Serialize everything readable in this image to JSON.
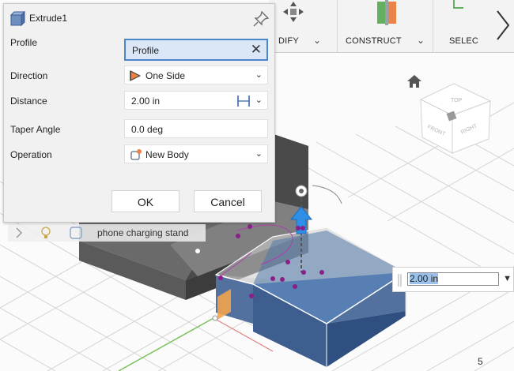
{
  "dialog": {
    "title": "Extrude1",
    "pin_icon": "pin-icon",
    "rows": {
      "profile": {
        "label": "Profile",
        "value": "Profile"
      },
      "direction": {
        "label": "Direction",
        "value": "One Side"
      },
      "distance": {
        "label": "Distance",
        "value": "2.00 in"
      },
      "taper": {
        "label": "Taper Angle",
        "value": "0.0 deg"
      },
      "operation": {
        "label": "Operation",
        "value": "New Body"
      }
    },
    "ok_label": "OK",
    "cancel_label": "Cancel"
  },
  "toolbar": {
    "modify_label": "DIFY",
    "construct_label": "CONSTRUCT",
    "select_label": "SELEC"
  },
  "viewcube": {
    "top": "TOP",
    "front": "FRONT",
    "right": "RIGHT"
  },
  "browser": {
    "item_label": "phone charging stand"
  },
  "distance_entry": {
    "value": "2.00 in"
  },
  "page_number": "5",
  "colors": {
    "accent": "#4a86c8",
    "selection_face": "#4f76a8",
    "arrow": "#2f8fe6",
    "handle": "#8a1f8a"
  }
}
